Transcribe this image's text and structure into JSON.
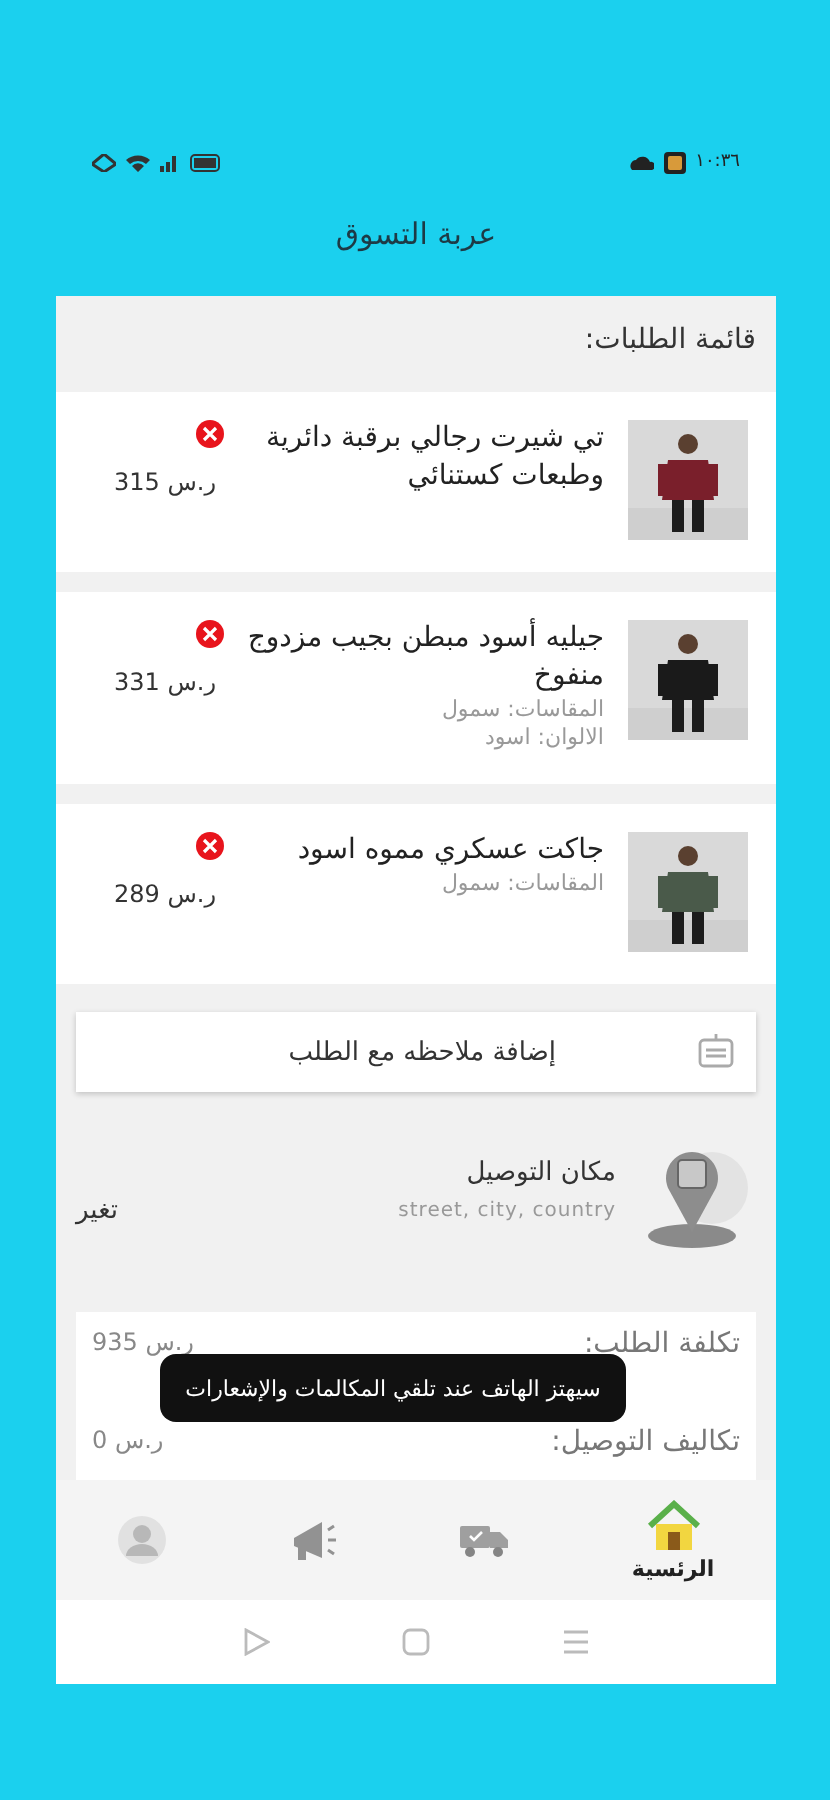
{
  "status_bar": {
    "time": "١٠:٣٦"
  },
  "header": {
    "title": "عربة التسوق"
  },
  "orders_title": "قائمة الطلبات:",
  "items": [
    {
      "name": "تي شيرت رجالي برقبة دائرية وطبعات كستنائي",
      "price": "315 ر.س"
    },
    {
      "name": "جيليه أسود مبطن بجيب مزدوج منفوخ",
      "price": "331 ر.س",
      "details": [
        "المقاسات: سمول",
        "الالوان: اسود"
      ]
    },
    {
      "name": "جاكت عسكري مموه اسود",
      "price": "289 ر.س",
      "details": [
        "المقاسات: سمول"
      ]
    }
  ],
  "note_button": {
    "label": "إضافة ملاحظه مع الطلب"
  },
  "delivery": {
    "title": "مكان التوصيل",
    "address": "street, city, country",
    "change": "تغير"
  },
  "costs": [
    {
      "label": "تكلفة الطلب:",
      "value": "935 ر.س"
    },
    {
      "label": "تكاليف التوصيل:",
      "value": "0 ر.س"
    }
  ],
  "toast": "سيهتز الهاتف عند تلقي المكالمات والإشعارات",
  "bottom_nav": [
    {
      "kind": "home",
      "label": "الرئسية",
      "selected": true
    },
    {
      "kind": "truck",
      "selected": false
    },
    {
      "kind": "megaphone",
      "selected": false
    },
    {
      "kind": "profile",
      "selected": false
    }
  ]
}
